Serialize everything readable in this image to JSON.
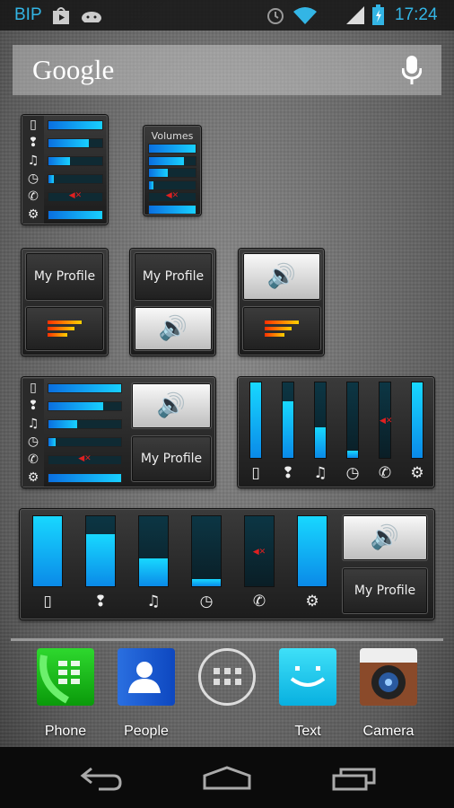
{
  "status_bar": {
    "carrier": "BIP",
    "time": "17:24",
    "icons": [
      "play-store-icon",
      "android-icon",
      "alarm-icon",
      "wifi-icon",
      "signal-icon",
      "battery-charging-icon"
    ],
    "accent": "#33b5e5"
  },
  "search": {
    "logo": "Google",
    "icon": "mic-icon"
  },
  "channels": [
    {
      "name": "ringer",
      "icon": "ringer-icon",
      "glyph": "▯",
      "level": 1.0,
      "muted": false
    },
    {
      "name": "notification",
      "icon": "notification-icon",
      "glyph": "❢",
      "level": 0.75,
      "muted": false
    },
    {
      "name": "media",
      "icon": "music-icon",
      "glyph": "♫",
      "level": 0.4,
      "muted": false
    },
    {
      "name": "alarm",
      "icon": "alarm-icon",
      "glyph": "◷",
      "level": 0.1,
      "muted": false
    },
    {
      "name": "call",
      "icon": "phone-icon",
      "glyph": "✆",
      "level": 0,
      "muted": true
    },
    {
      "name": "system",
      "icon": "gear-icon",
      "glyph": "⚙",
      "level": 1.0,
      "muted": false
    }
  ],
  "widgets": {
    "volumes_title": "Volumes",
    "profile_label": "My Profile",
    "speaker_glyph": "🔊",
    "mute_glyph": "◀✕"
  },
  "dock": [
    {
      "label": "Phone",
      "icon": "phone-app-icon"
    },
    {
      "label": "People",
      "icon": "people-app-icon"
    },
    {
      "label": "",
      "icon": "app-drawer-icon"
    },
    {
      "label": "Text",
      "icon": "messaging-app-icon"
    },
    {
      "label": "Camera",
      "icon": "camera-app-icon"
    }
  ],
  "nav": {
    "back": "back-icon",
    "home": "home-icon",
    "recents": "recents-icon"
  },
  "colors": {
    "fill_start": "#0a6fe0",
    "fill_end": "#18d0ff",
    "mute": "#e02020"
  }
}
